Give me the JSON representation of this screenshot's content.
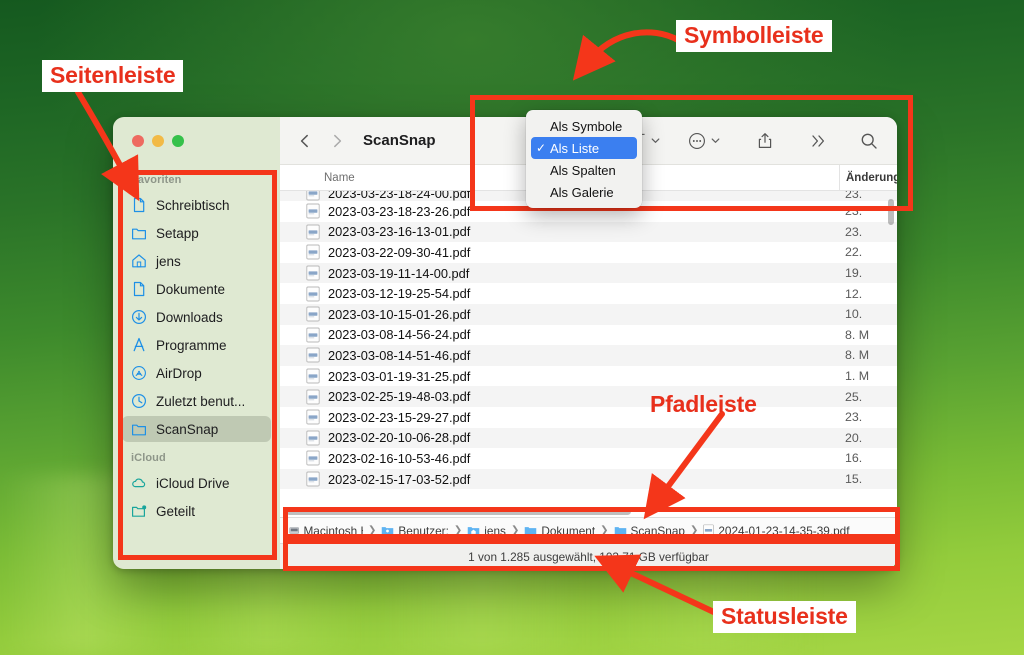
{
  "annotations": [
    {
      "id": "seitenleiste",
      "label": "Seitenleiste"
    },
    {
      "id": "symbolleiste",
      "label": "Symbolleiste"
    },
    {
      "id": "pfadleiste",
      "label": "Pfadleiste"
    },
    {
      "id": "statusleiste",
      "label": "Statusleiste"
    }
  ],
  "window": {
    "traffic_lights": [
      "close",
      "minimize",
      "zoom"
    ],
    "toolbar": {
      "back_label": "‹",
      "forward_label": "›",
      "title": "ScanSnap",
      "group_icon": "group-items-icon",
      "more_icon": "more-options-icon",
      "share_icon": "share-icon",
      "overflow_label": "»",
      "search_icon": "search-icon"
    },
    "sidebar": {
      "sections": [
        {
          "title": "Favoriten",
          "items": [
            {
              "label": "Schreibtisch",
              "icon": "document-icon",
              "selected": false
            },
            {
              "label": "Setapp",
              "icon": "folder-icon",
              "selected": false
            },
            {
              "label": "jens",
              "icon": "home-icon",
              "selected": false
            },
            {
              "label": "Dokumente",
              "icon": "document-icon",
              "selected": false
            },
            {
              "label": "Downloads",
              "icon": "download-icon",
              "selected": false
            },
            {
              "label": "Programme",
              "icon": "apps-icon",
              "selected": false
            },
            {
              "label": "AirDrop",
              "icon": "airdrop-icon",
              "selected": false
            },
            {
              "label": "Zuletzt benut...",
              "icon": "clock-icon",
              "selected": false
            },
            {
              "label": "ScanSnap",
              "icon": "folder-icon",
              "selected": true
            }
          ]
        },
        {
          "title": "iCloud",
          "items": [
            {
              "label": "iCloud Drive",
              "icon": "cloud-icon",
              "selected": false
            },
            {
              "label": "Geteilt",
              "icon": "shared-folder-icon",
              "selected": false
            }
          ]
        }
      ]
    },
    "list": {
      "columns": {
        "name": "Name",
        "modified": "Änderungsdatum"
      },
      "rows": [
        {
          "name": "2023-03-23-18-24-00.pdf",
          "modified": "23.",
          "clipped": true
        },
        {
          "name": "2023-03-23-18-23-26.pdf",
          "modified": "23."
        },
        {
          "name": "2023-03-23-16-13-01.pdf",
          "modified": "23."
        },
        {
          "name": "2023-03-22-09-30-41.pdf",
          "modified": "22."
        },
        {
          "name": "2023-03-19-11-14-00.pdf",
          "modified": "19."
        },
        {
          "name": "2023-03-12-19-25-54.pdf",
          "modified": "12."
        },
        {
          "name": "2023-03-10-15-01-26.pdf",
          "modified": "10."
        },
        {
          "name": "2023-03-08-14-56-24.pdf",
          "modified": "8. M"
        },
        {
          "name": "2023-03-08-14-51-46.pdf",
          "modified": "8. M"
        },
        {
          "name": "2023-03-01-19-31-25.pdf",
          "modified": "1. M"
        },
        {
          "name": "2023-02-25-19-48-03.pdf",
          "modified": "25."
        },
        {
          "name": "2023-02-23-15-29-27.pdf",
          "modified": "23."
        },
        {
          "name": "2023-02-20-10-06-28.pdf",
          "modified": "20."
        },
        {
          "name": "2023-02-16-10-53-46.pdf",
          "modified": "16."
        },
        {
          "name": "2023-02-15-17-03-52.pdf",
          "modified": "15."
        }
      ]
    },
    "pathbar": [
      {
        "label": "Macintosh HD",
        "icon": "harddisk-icon"
      },
      {
        "label": "Benutzer:",
        "icon": "users-folder-icon"
      },
      {
        "label": "jens",
        "icon": "home-folder-icon"
      },
      {
        "label": "Dokument",
        "icon": "folder-icon"
      },
      {
        "label": "ScanSnap",
        "icon": "folder-icon"
      },
      {
        "label": "2024-01-23-14-35-39.pdf",
        "icon": "pdf-icon"
      }
    ],
    "statusbar": {
      "text": "1 von 1.285 ausgewählt, 103,71 GB verfügbar"
    }
  },
  "view_menu": {
    "items": [
      {
        "label": "Als Symbole",
        "checked": false
      },
      {
        "label": "Als Liste",
        "checked": true
      },
      {
        "label": "Als Spalten",
        "checked": false
      },
      {
        "label": "Als Galerie",
        "checked": false
      }
    ],
    "check_glyph": "✓"
  },
  "colors": {
    "annotation_red": "#f4361a",
    "label_red": "#e8301c",
    "menu_highlight": "#3b7ff0",
    "sidebar_bg": "#dfe9d2"
  }
}
